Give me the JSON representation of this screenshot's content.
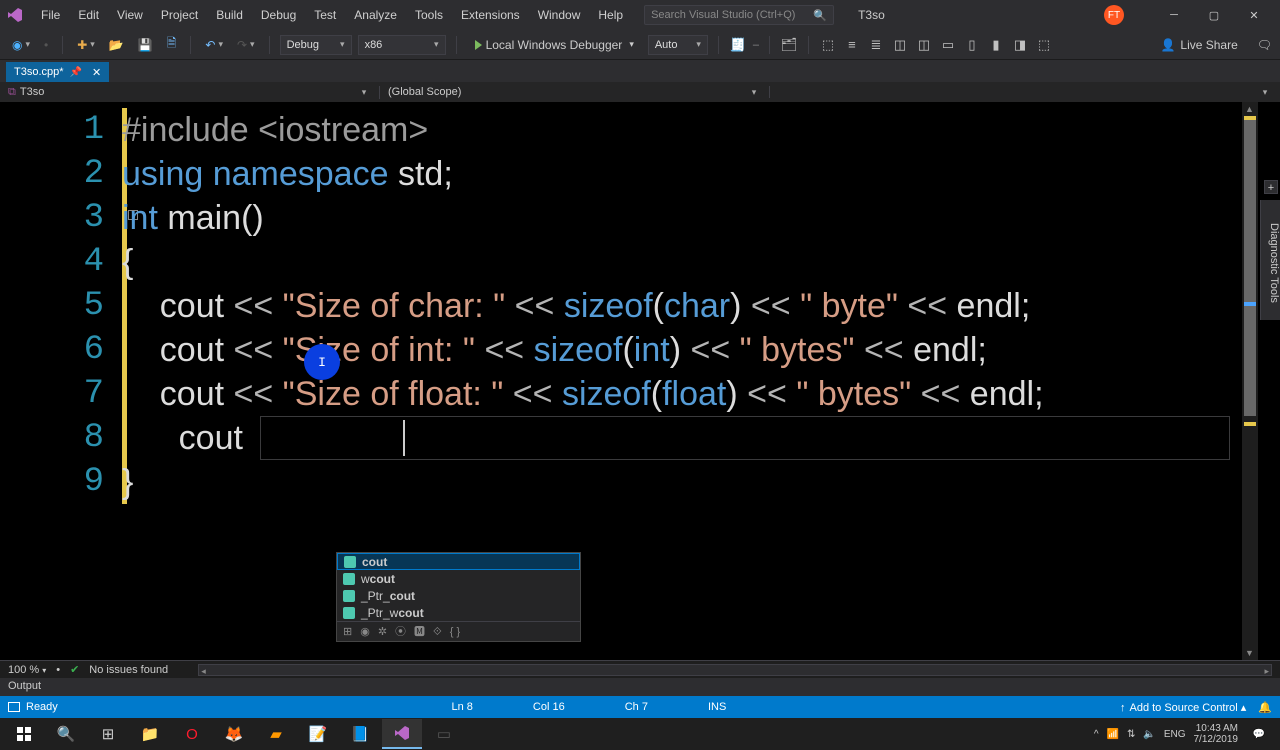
{
  "window": {
    "title": "T3so"
  },
  "menu": [
    "File",
    "Edit",
    "View",
    "Project",
    "Build",
    "Debug",
    "Test",
    "Analyze",
    "Tools",
    "Extensions",
    "Window",
    "Help"
  ],
  "search_placeholder": "Search Visual Studio (Ctrl+Q)",
  "avatar_initials": "FT",
  "toolbar": {
    "config": "Debug",
    "platform": "x86",
    "debugger": "Local Windows Debugger",
    "auto": "Auto",
    "live_share": "Live Share"
  },
  "tab": {
    "name": "T3so.cpp*",
    "project": "T3so",
    "scope": "(Global Scope)"
  },
  "right_rail": "Diagnostic Tools",
  "code": {
    "lines": [
      "1",
      "2",
      "3",
      "4",
      "5",
      "6",
      "7",
      "8",
      "9"
    ],
    "l1_a": "#include ",
    "l1_b": "<iostream>",
    "l2_a": "using",
    "l2_b": " namespace",
    "l2_c": " std",
    "l2_d": ";",
    "l3_a": "int",
    "l3_b": " main",
    "l3_c": "()",
    "l4": "{",
    "l5_a": "    cout ",
    "l5_b": "<<",
    "l5_c": " \"Size of char: \" ",
    "l5_d": "<<",
    "l5_e": " sizeof",
    "l5_f": "(",
    "l5_g": "char",
    "l5_h": ") ",
    "l5_i": "<<",
    "l5_j": " \" byte\" ",
    "l5_k": "<<",
    "l5_l": " endl",
    "l5_m": ";",
    "l6_a": "    cout ",
    "l6_b": "<<",
    "l6_c": " \"Size of int: \" ",
    "l6_d": "<<",
    "l6_e": " sizeof",
    "l6_f": "(",
    "l6_g": "int",
    "l6_h": ") ",
    "l6_i": "<<",
    "l6_j": " \" bytes\" ",
    "l6_k": "<<",
    "l6_l": " endl",
    "l6_m": ";",
    "l7_a": "    cout ",
    "l7_b": "<<",
    "l7_c": " \"Size of float: \" ",
    "l7_d": "<<",
    "l7_e": " sizeof",
    "l7_f": "(",
    "l7_g": "float",
    "l7_h": ") ",
    "l7_i": "<<",
    "l7_j": " \" bytes\" ",
    "l7_k": "<<",
    "l7_l": " endl",
    "l7_m": ";",
    "l8": "      cout",
    "l9": "}"
  },
  "intellisense": {
    "items": [
      "cout",
      "wcout",
      "_Ptr_cout",
      "_Ptr_wcout"
    ]
  },
  "editor_status": {
    "zoom": "100 %",
    "issues": "No issues found"
  },
  "output_label": "Output",
  "status": {
    "ready": "Ready",
    "ln": "Ln 8",
    "col": "Col 16",
    "ch": "Ch 7",
    "ins": "INS",
    "add_src": "Add to Source Control"
  },
  "tray": {
    "chev": "^",
    "wifi": "⇅",
    "vol": "🔈",
    "lang": "ENG",
    "time": "10:43 AM",
    "date": "7/12/2019"
  }
}
